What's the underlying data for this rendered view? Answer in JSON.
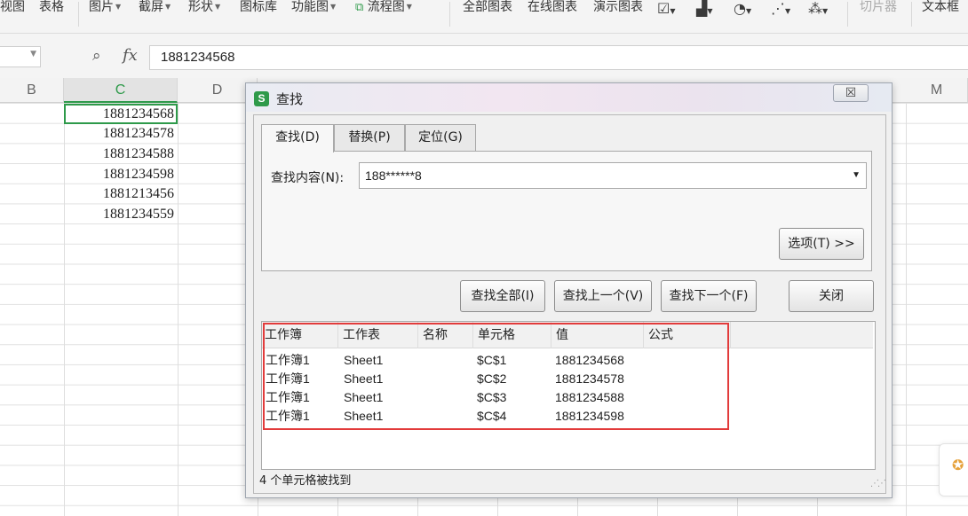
{
  "ribbon": {
    "items": [
      {
        "label": "视图",
        "caret": false
      },
      {
        "label": "表格",
        "caret": false
      },
      {
        "label": "图片",
        "caret": true
      },
      {
        "label": "截屏",
        "caret": true
      },
      {
        "label": "形状",
        "caret": true
      },
      {
        "label": "图标库",
        "caret": false
      },
      {
        "label": "功能图",
        "caret": true
      },
      {
        "label": "流程图",
        "caret": true
      },
      {
        "label": "全部图表",
        "caret": false
      },
      {
        "label": "在线图表",
        "caret": false
      },
      {
        "label": "演示图表",
        "caret": false
      },
      {
        "label": "切片器",
        "caret": false
      },
      {
        "label": "文本框",
        "caret": false
      }
    ],
    "chart_icons": [
      "line-chart-icon",
      "bar-chart-icon",
      "pie-chart-icon",
      "scatter-chart-icon",
      "more-chart-icon"
    ]
  },
  "formula_bar": {
    "name_box": "",
    "fx": "fx",
    "value": "1881234568"
  },
  "sheet": {
    "columns": [
      "B",
      "C",
      "D",
      "M"
    ],
    "selected_column": "C",
    "cells": [
      "1881234568",
      "1881234578",
      "1881234588",
      "1881234598",
      "1881213456",
      "1881234559"
    ]
  },
  "dialog": {
    "title": "查找",
    "close_symbol": "☒",
    "tabs": [
      "查找(D)",
      "替换(P)",
      "定位(G)"
    ],
    "find_label": "查找内容(N):",
    "find_value": "188******8",
    "options_button": "选项(T) >>",
    "buttons": {
      "find_all": "查找全部(I)",
      "find_prev": "查找上一个(V)",
      "find_next": "查找下一个(F)",
      "close": "关闭"
    },
    "results": {
      "headers": [
        "工作簿",
        "工作表",
        "名称",
        "单元格",
        "值",
        "公式"
      ],
      "rows": [
        [
          "工作簿1",
          "Sheet1",
          "",
          "$C$1",
          "1881234568",
          ""
        ],
        [
          "工作簿1",
          "Sheet1",
          "",
          "$C$2",
          "1881234578",
          ""
        ],
        [
          "工作簿1",
          "Sheet1",
          "",
          "$C$3",
          "1881234588",
          ""
        ],
        [
          "工作簿1",
          "Sheet1",
          "",
          "$C$4",
          "1881234598",
          ""
        ]
      ]
    },
    "status": "4 个单元格被找到"
  },
  "colors": {
    "accent_green": "#2e9a4a",
    "highlight_red": "#e23b3b"
  }
}
